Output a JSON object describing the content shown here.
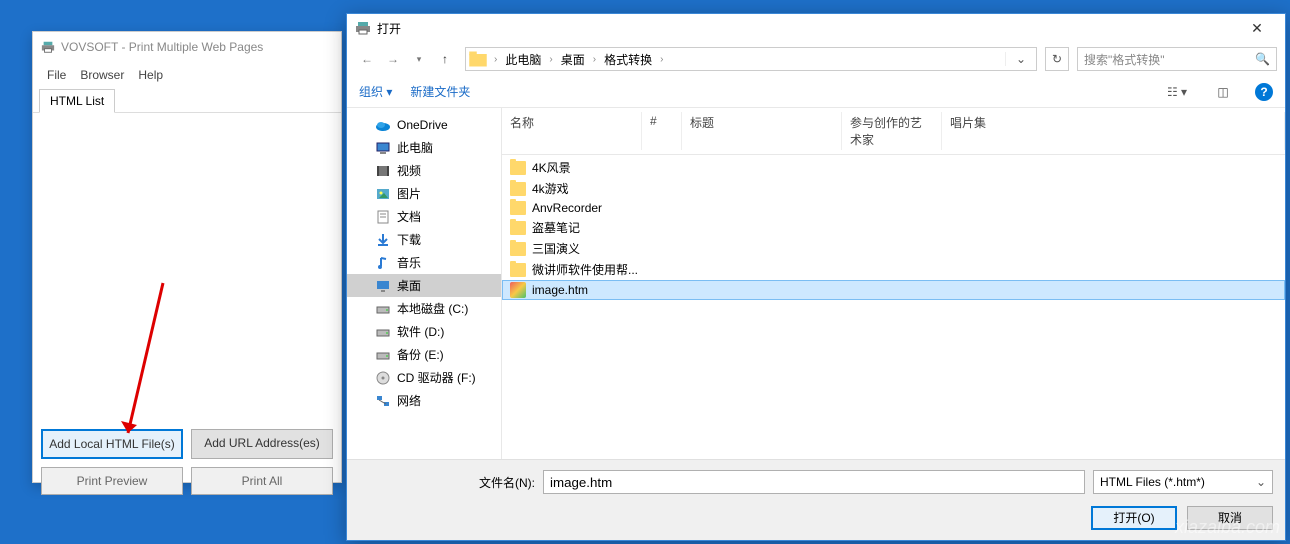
{
  "backwin": {
    "title": "VOVSOFT - Print Multiple Web Pages",
    "menu": [
      "File",
      "Browser",
      "Help"
    ],
    "tab": "HTML List",
    "buttons": {
      "add_local": "Add Local HTML File(s)",
      "add_url": "Add URL Address(es)",
      "preview": "Print Preview",
      "print_all": "Print All"
    }
  },
  "dialog": {
    "title": "打开",
    "breadcrumb": [
      "此电脑",
      "桌面",
      "格式转换"
    ],
    "search_placeholder": "搜索\"格式转换\"",
    "toolbar": {
      "organize": "组织",
      "newfolder": "新建文件夹"
    },
    "tree": [
      {
        "label": "OneDrive",
        "icon": "onedrive",
        "lv": 1
      },
      {
        "label": "此电脑",
        "icon": "pc",
        "lv": 1
      },
      {
        "label": "视频",
        "icon": "video",
        "lv": 2
      },
      {
        "label": "图片",
        "icon": "pic",
        "lv": 2
      },
      {
        "label": "文档",
        "icon": "doc",
        "lv": 2
      },
      {
        "label": "下载",
        "icon": "dl",
        "lv": 2
      },
      {
        "label": "音乐",
        "icon": "music",
        "lv": 2
      },
      {
        "label": "桌面",
        "icon": "desktop",
        "lv": 2,
        "sel": true
      },
      {
        "label": "本地磁盘 (C:)",
        "icon": "disk",
        "lv": 2
      },
      {
        "label": "软件 (D:)",
        "icon": "disk",
        "lv": 2
      },
      {
        "label": "备份 (E:)",
        "icon": "disk",
        "lv": 2
      },
      {
        "label": "CD 驱动器 (F:)",
        "icon": "cd",
        "lv": 2
      },
      {
        "label": "网络",
        "icon": "net",
        "lv": 1
      }
    ],
    "columns": {
      "name": "名称",
      "num": "#",
      "title": "标题",
      "artist": "参与创作的艺术家",
      "album": "唱片集"
    },
    "files": [
      {
        "name": "4K风景",
        "type": "folder"
      },
      {
        "name": "4k游戏",
        "type": "folder"
      },
      {
        "name": "AnvRecorder",
        "type": "folder"
      },
      {
        "name": "盗墓笔记",
        "type": "folder"
      },
      {
        "name": "三国演义",
        "type": "folder"
      },
      {
        "name": "微讲师软件使用帮...",
        "type": "folder"
      },
      {
        "name": "image.htm",
        "type": "htm",
        "sel": true
      }
    ],
    "footer": {
      "filename_label": "文件名(N):",
      "filename_value": "image.htm",
      "filetype": "HTML Files (*.htm*)",
      "open": "打开(O)",
      "cancel": "取消"
    }
  },
  "watermark": "xiazaiba.com"
}
